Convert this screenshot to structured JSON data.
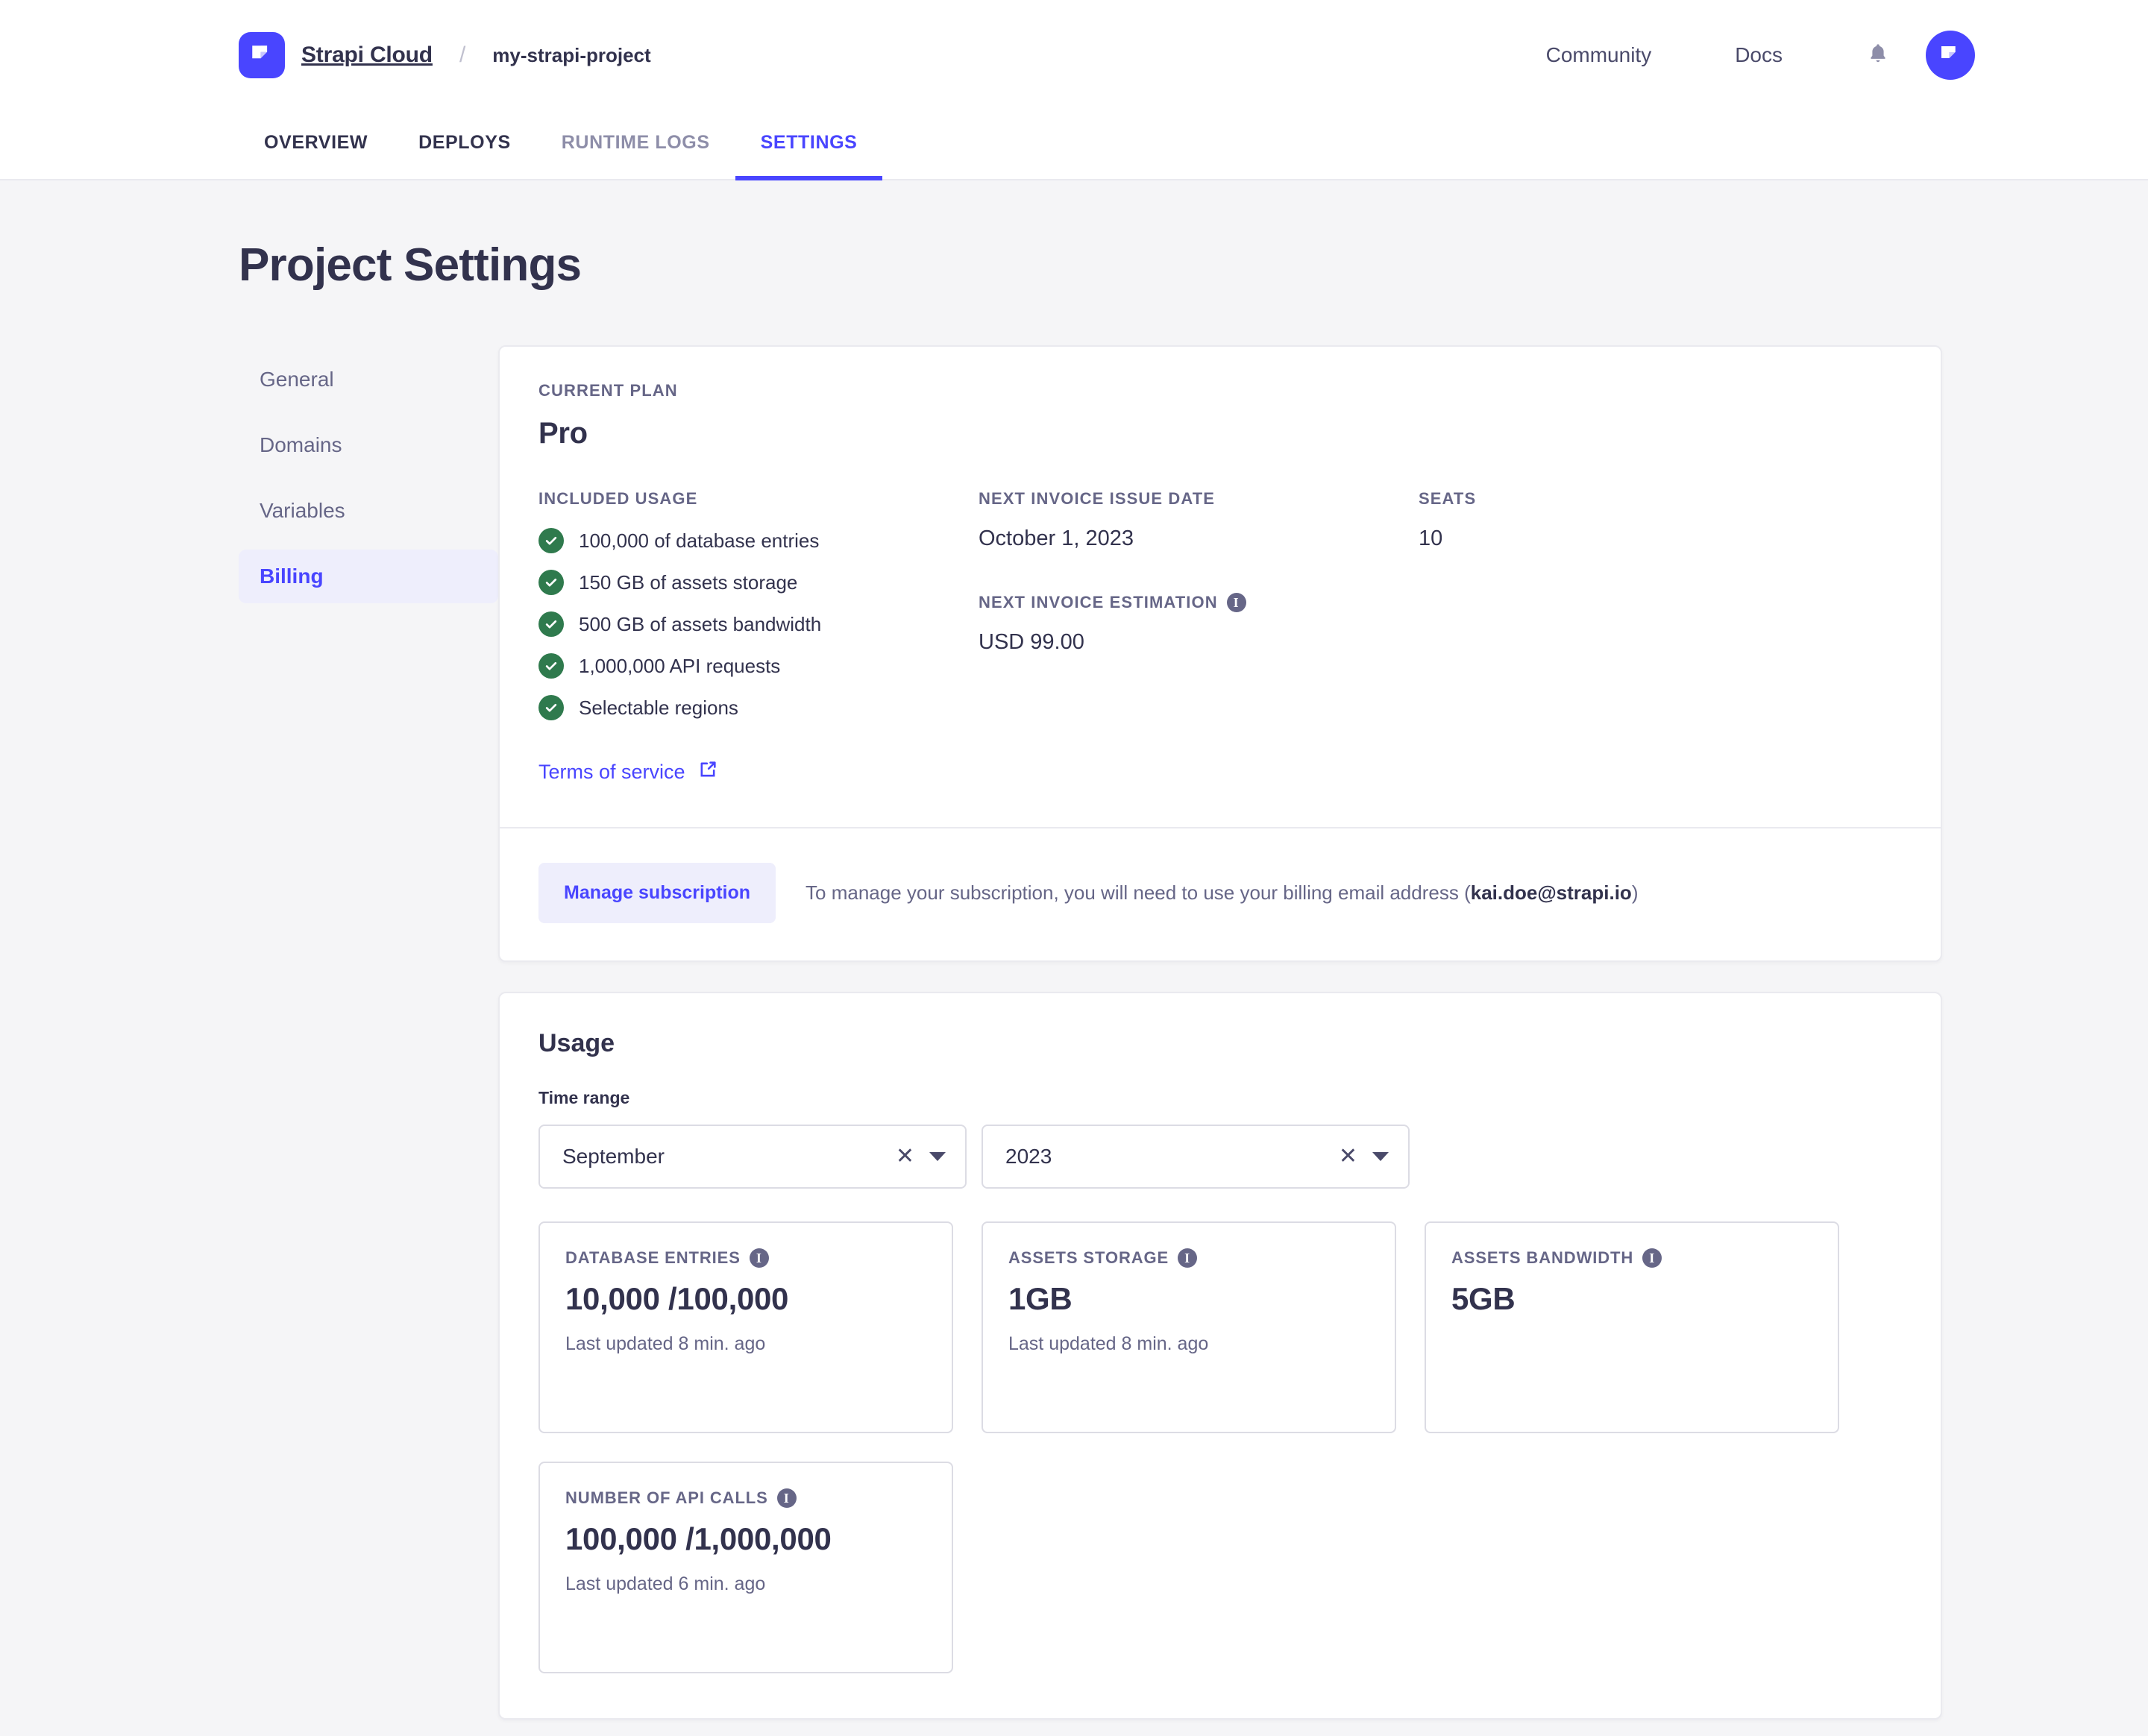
{
  "header": {
    "brand_name": "Strapi Cloud",
    "separator": "/",
    "project_name": "my-strapi-project",
    "community_label": "Community",
    "docs_label": "Docs"
  },
  "tabs": [
    {
      "label": "OVERVIEW",
      "state": "normal"
    },
    {
      "label": "DEPLOYS",
      "state": "normal"
    },
    {
      "label": "RUNTIME LOGS",
      "state": "muted"
    },
    {
      "label": "SETTINGS",
      "state": "active"
    }
  ],
  "page": {
    "title": "Project Settings"
  },
  "sidebar": {
    "items": [
      {
        "label": "General",
        "active": false
      },
      {
        "label": "Domains",
        "active": false
      },
      {
        "label": "Variables",
        "active": false
      },
      {
        "label": "Billing",
        "active": true
      }
    ]
  },
  "plan": {
    "eyebrow": "CURRENT PLAN",
    "name": "Pro",
    "included_usage_label": "INCLUDED USAGE",
    "features": [
      "100,000 of database entries",
      "150 GB of assets storage",
      "500 GB of assets bandwidth",
      "1,000,000 API requests",
      "Selectable regions"
    ],
    "terms_label": "Terms of service",
    "next_invoice_date_label": "NEXT INVOICE ISSUE DATE",
    "next_invoice_date_value": "October 1, 2023",
    "next_invoice_estimation_label": "NEXT INVOICE ESTIMATION",
    "next_invoice_estimation_value": "USD 99.00",
    "seats_label": "SEATS",
    "seats_value": "10",
    "manage_button": "Manage subscription",
    "manage_note_before": "To manage your subscription, you will need to use your billing email address (",
    "manage_note_email": "kai.doe@strapi.io",
    "manage_note_after": ")"
  },
  "usage": {
    "title": "Usage",
    "time_range_label": "Time range",
    "month_select": {
      "value": "September"
    },
    "year_select": {
      "value": "2023"
    },
    "metrics": [
      {
        "label": "DATABASE ENTRIES",
        "value": "10,000 /100,000",
        "updated": "Last updated 8 min. ago"
      },
      {
        "label": "ASSETS STORAGE",
        "value": "1GB",
        "updated": "Last updated 8 min. ago"
      },
      {
        "label": "ASSETS BANDWIDTH",
        "value": "5GB",
        "updated": ""
      },
      {
        "label": "NUMBER OF API CALLS",
        "value": "100,000 /1,000,000",
        "updated": "Last updated 6 min. ago"
      }
    ]
  },
  "colors": {
    "accent": "#4945ff",
    "accent_soft": "#eeeefc",
    "success": "#2f7a4d",
    "text": "#32324d",
    "muted": "#666687",
    "page_bg": "#f5f5f7",
    "border": "#eaeaef"
  },
  "icons": {
    "bell": "bell-icon",
    "external_link": "external-link-icon",
    "info": "i",
    "clear": "✕"
  }
}
